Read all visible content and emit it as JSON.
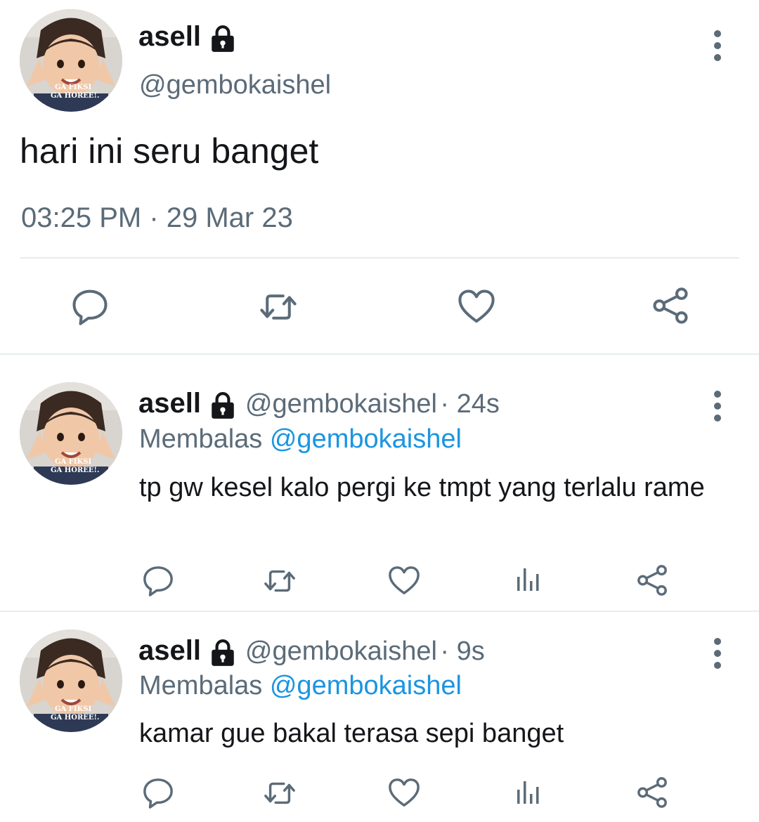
{
  "main_tweet": {
    "display_name": "asell",
    "handle": "@gembokaishel",
    "text": "hari ini seru banget",
    "timestamp": "03:25 PM · 29 Mar 23",
    "avatar_caption_line1": "GA FIKSI",
    "avatar_caption_line2": "GA HOREE!.",
    "actions": [
      "reply-icon",
      "retweet-icon",
      "like-icon",
      "share-icon"
    ]
  },
  "replies": [
    {
      "display_name": "asell",
      "handle": "@gembokaishel",
      "time": "· 24s",
      "replying_label": "Membalas",
      "replying_to": "@gembokaishel",
      "text": "tp gw kesel kalo pergi ke tmpt yang terlalu rame",
      "avatar_caption_line1": "GA FIKSI",
      "avatar_caption_line2": "GA HOREE!.",
      "actions": [
        "reply-icon",
        "retweet-icon",
        "like-icon",
        "analytics-icon",
        "share-icon"
      ]
    },
    {
      "display_name": "asell",
      "handle": "@gembokaishel",
      "time": "· 9s",
      "replying_label": "Membalas",
      "replying_to": "@gembokaishel",
      "text": "kamar gue bakal terasa sepi banget",
      "avatar_caption_line1": "GA FIKSI",
      "avatar_caption_line2": "GA HOREE!.",
      "actions": [
        "reply-icon",
        "retweet-icon",
        "like-icon",
        "analytics-icon",
        "share-icon"
      ]
    }
  ],
  "colors": {
    "text": "#141619",
    "secondary": "#5b6b78",
    "link": "#1b95e0",
    "divider": "#e6ecf0"
  }
}
